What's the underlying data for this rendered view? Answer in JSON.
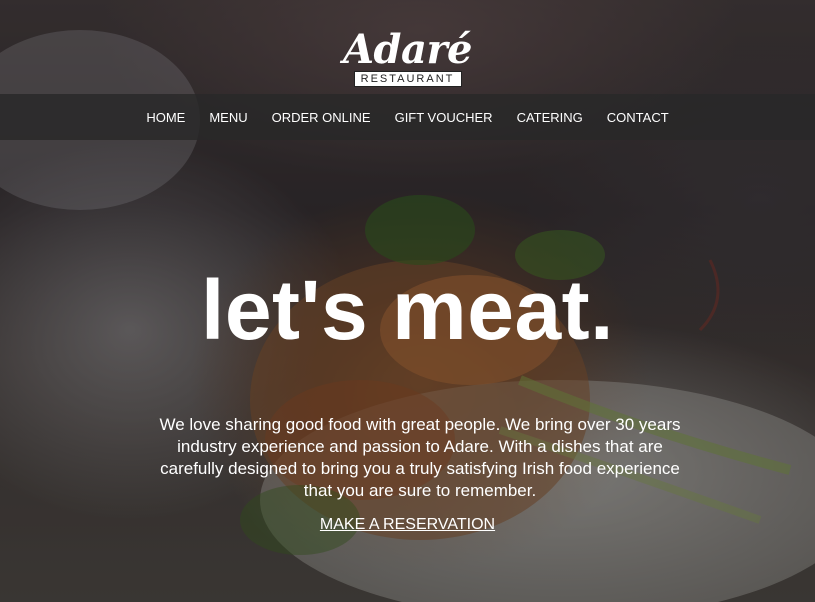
{
  "brand": {
    "name": "Adaré",
    "tagline": "RESTAURANT"
  },
  "nav": {
    "items": [
      {
        "label": "HOME"
      },
      {
        "label": "MENU"
      },
      {
        "label": "ORDER ONLINE"
      },
      {
        "label": "GIFT VOUCHER"
      },
      {
        "label": "CATERING"
      },
      {
        "label": "CONTACT"
      }
    ]
  },
  "hero": {
    "headline": "let's meat.",
    "intro": "We love sharing good food with great people. We bring over 30 years industry experience and passion to Adare. With a dishes that are carefully designed to bring you a truly satisfying Irish food experience that you are sure to remember.",
    "cta_label": "MAKE A RESERVATION",
    "background_image": "plated-meat-dish"
  },
  "colors": {
    "nav_background": "#2b2b2b",
    "text": "#ffffff",
    "logo_box_text": "#222222"
  }
}
